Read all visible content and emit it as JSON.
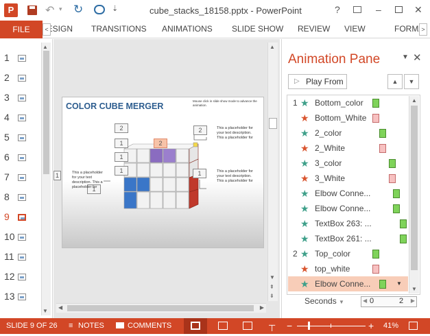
{
  "window": {
    "title": "cube_stacks_18158.pptx - PowerPoint",
    "help": "?",
    "minimize": "–",
    "close": "✕"
  },
  "ribbon": {
    "file": "FILE",
    "tabs": [
      "DESIGN",
      "TRANSITIONS",
      "ANIMATIONS",
      "SLIDE SHOW",
      "REVIEW",
      "VIEW",
      "FORMAT"
    ]
  },
  "slides": {
    "numbers": [
      "1",
      "2",
      "3",
      "4",
      "5",
      "6",
      "7",
      "8",
      "9",
      "10",
      "11",
      "12",
      "13"
    ],
    "selected": "9"
  },
  "slide": {
    "title": "COLOR CUBE MERGER",
    "hint": "Mouse click in slide show mode to advance the animation.",
    "placeholder_top": "This a placeholder for your text description. This a placeholder for",
    "placeholder_right": "This a placeholder for your text description. This a placeholder for",
    "placeholder_left": "This a placeholder for your text description. This a placeholder for",
    "boxes": [
      "2",
      "1",
      "1",
      "1",
      "2",
      "2",
      "1",
      "1",
      "1"
    ]
  },
  "animation_pane": {
    "title": "Animation Pane",
    "play_from": "Play From",
    "items": [
      {
        "num": "1",
        "label": "Bottom_color",
        "kind": "green",
        "star": "entrance"
      },
      {
        "num": "",
        "label": "Bottom_White",
        "kind": "red",
        "star": "emphasis"
      },
      {
        "num": "",
        "label": "2_color",
        "kind": "green",
        "star": "entrance"
      },
      {
        "num": "",
        "label": "2_White",
        "kind": "red",
        "star": "emphasis"
      },
      {
        "num": "",
        "label": "3_color",
        "kind": "green",
        "star": "entrance"
      },
      {
        "num": "",
        "label": "3_White",
        "kind": "red",
        "star": "emphasis"
      },
      {
        "num": "",
        "label": "Elbow Conne...",
        "kind": "green",
        "star": "entrance"
      },
      {
        "num": "",
        "label": "Elbow Conne...",
        "kind": "green",
        "star": "entrance"
      },
      {
        "num": "",
        "label": "TextBox 263: ...",
        "kind": "green",
        "star": "entrance"
      },
      {
        "num": "",
        "label": "TextBox 261: ...",
        "kind": "green",
        "star": "entrance"
      },
      {
        "num": "2",
        "label": "Top_color",
        "kind": "green",
        "star": "entrance"
      },
      {
        "num": "",
        "label": "top_white",
        "kind": "red",
        "star": "emphasis"
      },
      {
        "num": "",
        "label": "Elbow Conne...",
        "kind": "green",
        "star": "entrance"
      }
    ],
    "seconds_label": "Seconds",
    "timeline_start": "0",
    "timeline_end": "2"
  },
  "status": {
    "slide": "SLIDE 9 OF 26",
    "notes": "NOTES",
    "comments": "COMMENTS",
    "zoom": "41%"
  },
  "colors": {
    "accent": "#d24726",
    "entrance": "#3fa08a",
    "emphasis": "#d9552f"
  }
}
